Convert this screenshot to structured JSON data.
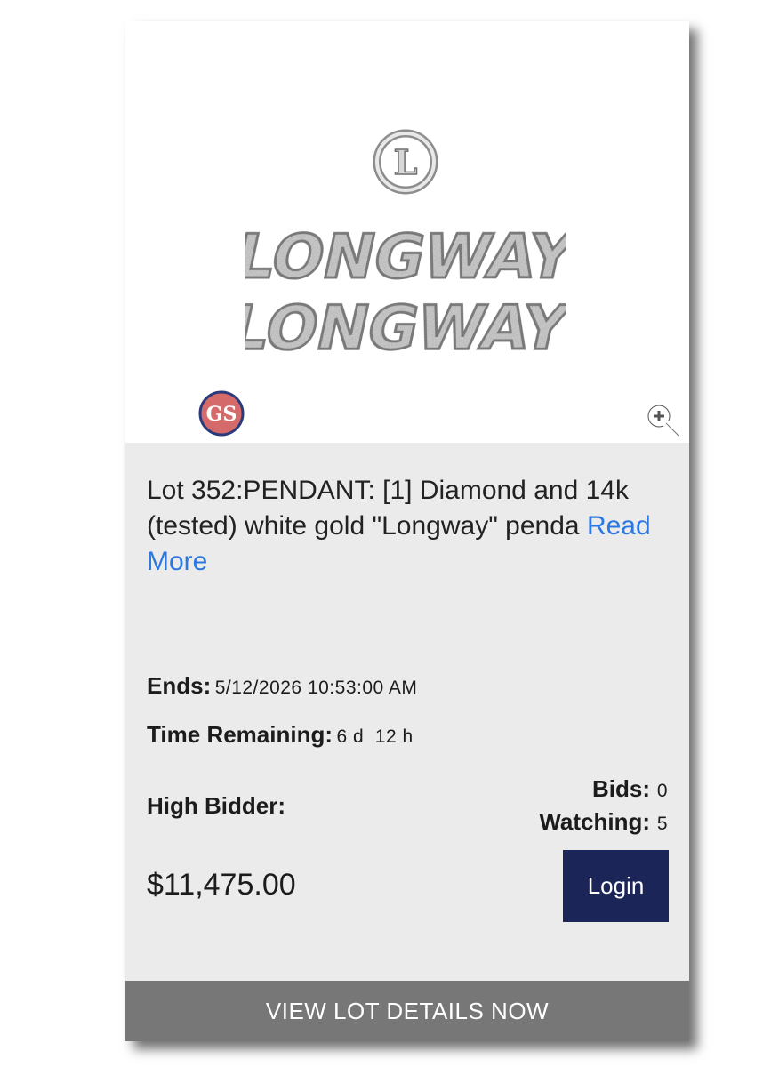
{
  "lot": {
    "title_prefix": "Lot 352:PENDANT: [1] Diamond and 14k (tested) white gold \"Longway\" penda",
    "read_more": "Read More",
    "pendant_text_line1": "LONGWAY",
    "pendant_text_line2": "LONGWAY",
    "pendant_monogram": "L",
    "seller_logo_text": "GS"
  },
  "details": {
    "ends_label": "Ends:",
    "ends_value": "5/12/2026 10:53:00 AM",
    "time_remaining_label": "Time Remaining:",
    "time_remaining_value": "6 d  12 h",
    "high_bidder_label": "High Bidder:",
    "bids_label": "Bids:",
    "bids_value": "0",
    "watching_label": "Watching:",
    "watching_value": "5"
  },
  "price": "$11,475.00",
  "login_label": "Login",
  "view_details_label": "VIEW LOT DETAILS NOW",
  "colors": {
    "login_bg": "#1b2557",
    "read_more": "#2a78e0",
    "view_details_bg": "#777777",
    "card_bg": "#ebebeb"
  },
  "icons": {
    "zoom": "zoom-in-icon",
    "seller_logo": "seller-logo"
  }
}
